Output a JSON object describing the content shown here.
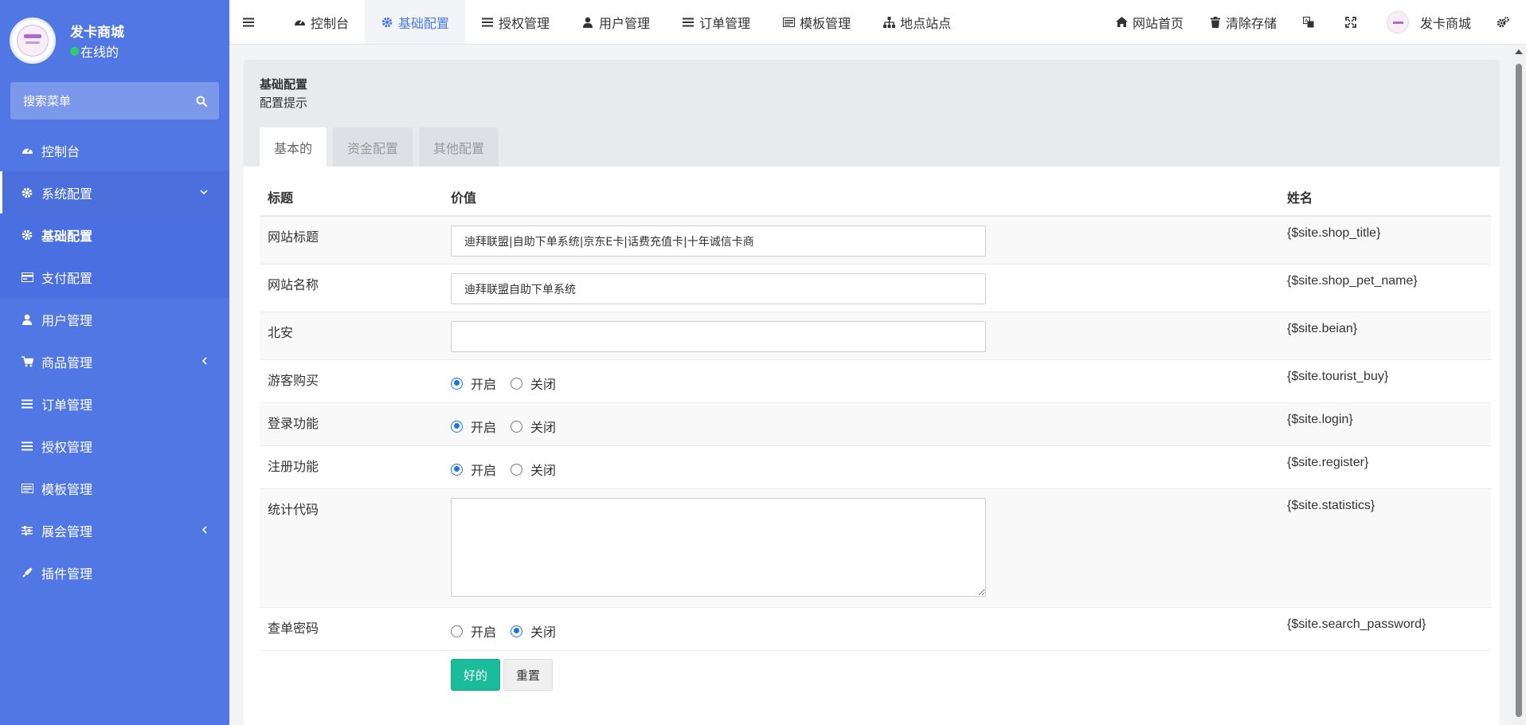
{
  "sidebar": {
    "user_name": "发卡商城",
    "status_text": "在线的",
    "search_placeholder": "搜索菜单",
    "items": [
      {
        "label": "控制台",
        "icon": "dashboard-icon"
      },
      {
        "label": "系统配置",
        "icon": "gear-icon"
      },
      {
        "label": "基础配置",
        "icon": "gear-icon"
      },
      {
        "label": "支付配置",
        "icon": "credit-card-icon"
      },
      {
        "label": "用户管理",
        "icon": "user-icon"
      },
      {
        "label": "商品管理",
        "icon": "cart-icon"
      },
      {
        "label": "订单管理",
        "icon": "list-icon"
      },
      {
        "label": "授权管理",
        "icon": "list-icon"
      },
      {
        "label": "模板管理",
        "icon": "template-icon"
      },
      {
        "label": "展会管理",
        "icon": "sliders-icon"
      },
      {
        "label": "插件管理",
        "icon": "plug-icon"
      }
    ]
  },
  "topnav": {
    "tabs": [
      {
        "label": "控制台",
        "icon": "dashboard-icon"
      },
      {
        "label": "基础配置",
        "icon": "gear-icon"
      },
      {
        "label": "授权管理",
        "icon": "list-icon"
      },
      {
        "label": "用户管理",
        "icon": "user-icon"
      },
      {
        "label": "订单管理",
        "icon": "list-icon"
      },
      {
        "label": "模板管理",
        "icon": "template-icon"
      },
      {
        "label": "地点站点",
        "icon": "sitemap-icon"
      }
    ],
    "home_label": "网站首页",
    "clear_label": "清除存储",
    "user_name": "发卡商城"
  },
  "page": {
    "title": "基础配置",
    "subtitle": "配置提示",
    "tabs": [
      "基本的",
      "资金配置",
      "其他配置"
    ]
  },
  "table": {
    "headers": [
      "标题",
      "价值",
      "姓名"
    ],
    "rows": [
      {
        "title": "网站标题",
        "type": "text",
        "value": "迪拜联盟|自助下单系统|京东E卡|话费充值卡|十年诚信卡商",
        "name": "{$site.shop_title}"
      },
      {
        "title": "网站名称",
        "type": "text",
        "value": "迪拜联盟自助下单系统",
        "name": "{$site.shop_pet_name}"
      },
      {
        "title": "北安",
        "type": "text",
        "value": "",
        "name": "{$site.beian}"
      },
      {
        "title": "游客购买",
        "type": "radio",
        "on": "开启",
        "off": "关闭",
        "checked": "on",
        "name": "{$site.tourist_buy}"
      },
      {
        "title": "登录功能",
        "type": "radio",
        "on": "开启",
        "off": "关闭",
        "checked": "on",
        "name": "{$site.login}"
      },
      {
        "title": "注册功能",
        "type": "radio",
        "on": "开启",
        "off": "关闭",
        "checked": "on",
        "name": "{$site.register}"
      },
      {
        "title": "统计代码",
        "type": "textarea",
        "value": "",
        "name": "{$site.statistics}"
      },
      {
        "title": "查单密码",
        "type": "radio",
        "on": "开启",
        "off": "关闭",
        "checked": "off",
        "name": "{$site.search_password}"
      }
    ]
  },
  "buttons": {
    "ok": "好的",
    "reset": "重置"
  },
  "colors": {
    "sidebar": "#5177e4",
    "accent": "#4a7ce0",
    "success": "#1abc9c",
    "online": "#2ecc71"
  }
}
